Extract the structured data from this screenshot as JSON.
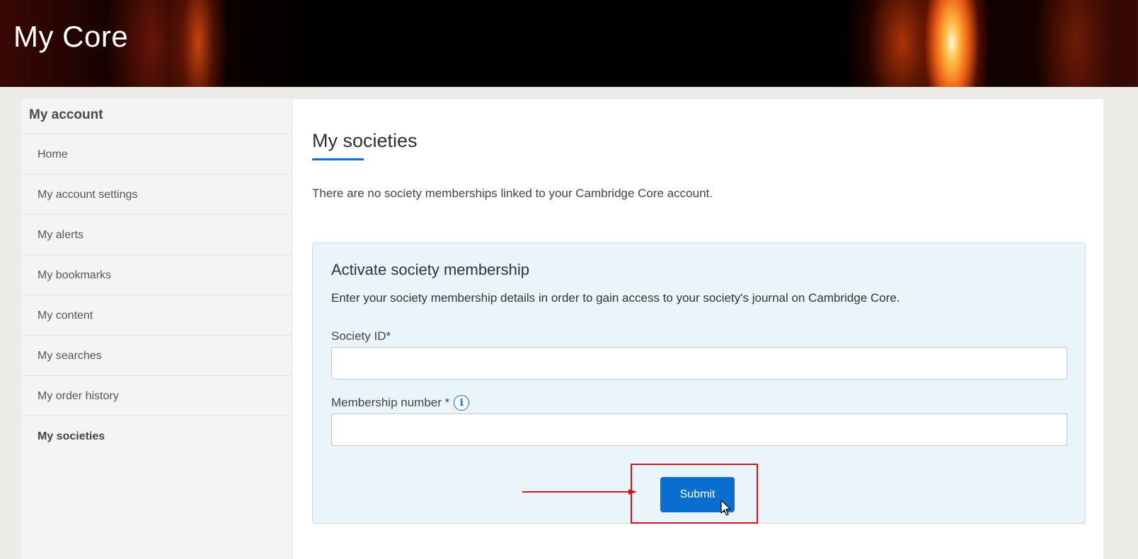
{
  "header": {
    "title": "My Core"
  },
  "sidebar": {
    "heading": "My account",
    "items": [
      {
        "label": "Home"
      },
      {
        "label": "My account settings"
      },
      {
        "label": "My alerts"
      },
      {
        "label": "My bookmarks"
      },
      {
        "label": "My content"
      },
      {
        "label": "My searches"
      },
      {
        "label": "My order history"
      },
      {
        "label": "My societies",
        "active": true
      }
    ]
  },
  "main": {
    "title": "My societies",
    "empty_message": "There are no society memberships linked to your Cambridge Core account.",
    "panel": {
      "title": "Activate society membership",
      "description": "Enter your society membership details in order to gain access to your society's journal on Cambridge Core.",
      "society_id_label": "Society ID*",
      "society_id_value": "",
      "membership_label": "Membership number *",
      "membership_value": "",
      "info_icon": "i",
      "submit_label": "Submit"
    }
  },
  "colors": {
    "accent": "#0a6ed1",
    "annotation": "#d0161b",
    "panel_bg": "#eaf4fb"
  }
}
